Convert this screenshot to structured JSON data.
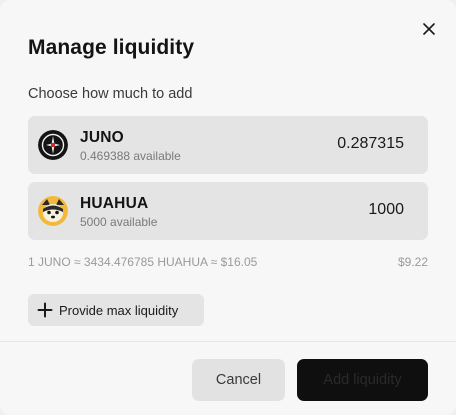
{
  "modal": {
    "title": "Manage liquidity",
    "subtitle": "Choose how much to add"
  },
  "tokens": [
    {
      "symbol": "JUNO",
      "available": "0.469388 available",
      "amount": "0.287315",
      "icon": "juno-token-icon"
    },
    {
      "symbol": "HUAHUA",
      "available": "5000 available",
      "amount": "1000",
      "icon": "huahua-token-icon"
    }
  ],
  "rate": {
    "text": "1 JUNO ≈ 3434.476785 HUAHUA ≈ $16.05",
    "total_usd": "$9.22"
  },
  "buttons": {
    "max_liquidity": "Provide max liquidity",
    "cancel": "Cancel",
    "add_liquidity": "Add liquidity"
  },
  "colors": {
    "background": "#f7f7f7",
    "row_background": "#e4e4e4",
    "primary_button": "#0f0f0f"
  }
}
